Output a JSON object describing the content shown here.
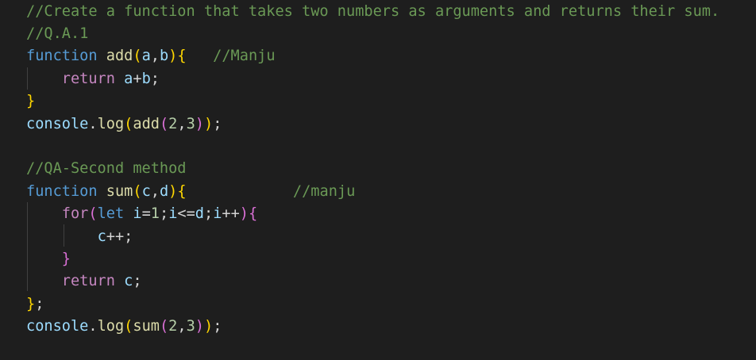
{
  "editor": {
    "lines": [
      [
        {
          "text": "//Create a function that takes two numbers as arguments and returns their sum.",
          "type": "cmt"
        }
      ],
      [
        {
          "text": "//Q.A.1",
          "type": "cmt"
        }
      ],
      [
        {
          "text": "function",
          "type": "kw"
        },
        {
          "text": " ",
          "type": "op"
        },
        {
          "text": "add",
          "type": "fn"
        },
        {
          "text": "(",
          "type": "b1"
        },
        {
          "text": "a",
          "type": "var"
        },
        {
          "text": ",",
          "type": "op"
        },
        {
          "text": "b",
          "type": "var"
        },
        {
          "text": ")",
          "type": "b1"
        },
        {
          "text": "{",
          "type": "b1"
        },
        {
          "text": "   ",
          "type": "op"
        },
        {
          "text": "//Manju",
          "type": "cmt"
        }
      ],
      [
        {
          "text": "    ",
          "type": "op"
        },
        {
          "text": "return",
          "type": "ctrl"
        },
        {
          "text": " ",
          "type": "op"
        },
        {
          "text": "a",
          "type": "var"
        },
        {
          "text": "+",
          "type": "op"
        },
        {
          "text": "b",
          "type": "var"
        },
        {
          "text": ";",
          "type": "op"
        }
      ],
      [
        {
          "text": "}",
          "type": "b1"
        }
      ],
      [
        {
          "text": "console",
          "type": "var"
        },
        {
          "text": ".",
          "type": "op"
        },
        {
          "text": "log",
          "type": "fn"
        },
        {
          "text": "(",
          "type": "b1"
        },
        {
          "text": "add",
          "type": "fn"
        },
        {
          "text": "(",
          "type": "b2"
        },
        {
          "text": "2",
          "type": "num"
        },
        {
          "text": ",",
          "type": "op"
        },
        {
          "text": "3",
          "type": "num"
        },
        {
          "text": ")",
          "type": "b2"
        },
        {
          "text": ")",
          "type": "b1"
        },
        {
          "text": ";",
          "type": "op"
        }
      ],
      [],
      [
        {
          "text": "//QA-Second method",
          "type": "cmt"
        }
      ],
      [
        {
          "text": "function",
          "type": "kw"
        },
        {
          "text": " ",
          "type": "op"
        },
        {
          "text": "sum",
          "type": "fn"
        },
        {
          "text": "(",
          "type": "b1"
        },
        {
          "text": "c",
          "type": "var"
        },
        {
          "text": ",",
          "type": "op"
        },
        {
          "text": "d",
          "type": "var"
        },
        {
          "text": ")",
          "type": "b1"
        },
        {
          "text": "{",
          "type": "b1"
        },
        {
          "text": "            ",
          "type": "op"
        },
        {
          "text": "//manju",
          "type": "cmt"
        }
      ],
      [
        {
          "text": "    ",
          "type": "op"
        },
        {
          "text": "for",
          "type": "ctrl"
        },
        {
          "text": "(",
          "type": "b2"
        },
        {
          "text": "let",
          "type": "kw"
        },
        {
          "text": " ",
          "type": "op"
        },
        {
          "text": "i",
          "type": "var"
        },
        {
          "text": "=",
          "type": "op"
        },
        {
          "text": "1",
          "type": "num"
        },
        {
          "text": ";",
          "type": "op"
        },
        {
          "text": "i",
          "type": "var"
        },
        {
          "text": "<=",
          "type": "op"
        },
        {
          "text": "d",
          "type": "var"
        },
        {
          "text": ";",
          "type": "op"
        },
        {
          "text": "i",
          "type": "var"
        },
        {
          "text": "++",
          "type": "op"
        },
        {
          "text": ")",
          "type": "b2"
        },
        {
          "text": "{",
          "type": "b2"
        }
      ],
      [
        {
          "text": "        ",
          "type": "op"
        },
        {
          "text": "c",
          "type": "var"
        },
        {
          "text": "++;",
          "type": "op"
        }
      ],
      [
        {
          "text": "    ",
          "type": "op"
        },
        {
          "text": "}",
          "type": "b2"
        }
      ],
      [
        {
          "text": "    ",
          "type": "op"
        },
        {
          "text": "return",
          "type": "ctrl"
        },
        {
          "text": " ",
          "type": "op"
        },
        {
          "text": "c",
          "type": "var"
        },
        {
          "text": ";",
          "type": "op"
        }
      ],
      [
        {
          "text": "}",
          "type": "b1"
        },
        {
          "text": ";",
          "type": "op"
        }
      ],
      [
        {
          "text": "console",
          "type": "var"
        },
        {
          "text": ".",
          "type": "op"
        },
        {
          "text": "log",
          "type": "fn"
        },
        {
          "text": "(",
          "type": "b1"
        },
        {
          "text": "sum",
          "type": "fn"
        },
        {
          "text": "(",
          "type": "b2"
        },
        {
          "text": "2",
          "type": "num"
        },
        {
          "text": ",",
          "type": "op"
        },
        {
          "text": "3",
          "type": "num"
        },
        {
          "text": ")",
          "type": "b2"
        },
        {
          "text": ")",
          "type": "b1"
        },
        {
          "text": ";",
          "type": "op"
        }
      ]
    ],
    "colors": {
      "background": "#1e1e1e",
      "comment": "#6a9955",
      "keyword": "#569cd6",
      "control": "#c586c0",
      "function": "#dcdcaa",
      "variable": "#9cdcfe",
      "number": "#b5cea8",
      "bracket_level_1": "#ffd700",
      "bracket_level_2": "#da70d6"
    }
  }
}
